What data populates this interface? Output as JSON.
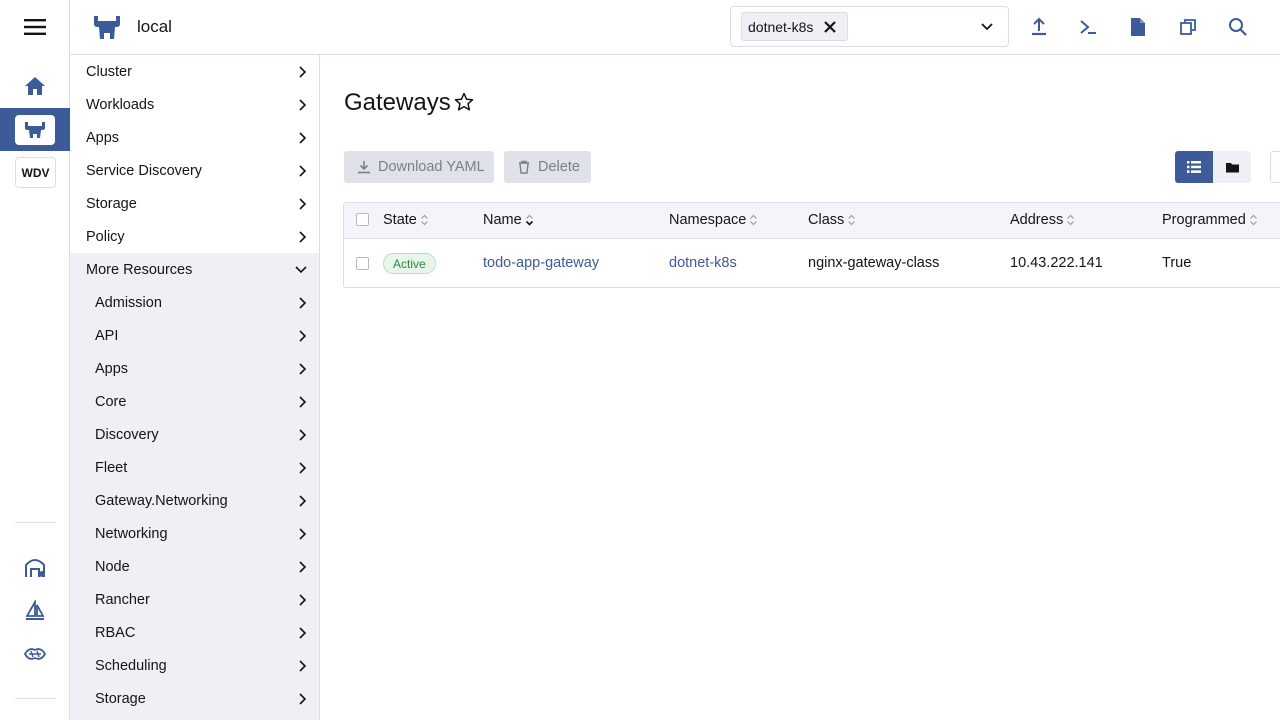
{
  "header": {
    "cluster_name": "local",
    "namespace_chip": "dotnet-k8s"
  },
  "rail": {
    "wdv_label": "WDV"
  },
  "sidenav": {
    "top_items": [
      {
        "label": "Cluster"
      },
      {
        "label": "Workloads"
      },
      {
        "label": "Apps"
      },
      {
        "label": "Service Discovery"
      },
      {
        "label": "Storage"
      },
      {
        "label": "Policy"
      }
    ],
    "open_group": {
      "label": "More Resources"
    },
    "sub_items": [
      {
        "label": "Admission"
      },
      {
        "label": "API"
      },
      {
        "label": "Apps"
      },
      {
        "label": "Core"
      },
      {
        "label": "Discovery"
      },
      {
        "label": "Fleet"
      },
      {
        "label": "Gateway.Networking"
      },
      {
        "label": "Networking"
      },
      {
        "label": "Node"
      },
      {
        "label": "Rancher"
      },
      {
        "label": "RBAC"
      },
      {
        "label": "Scheduling"
      },
      {
        "label": "Storage"
      }
    ]
  },
  "main": {
    "title": "Gateways",
    "download_label": "Download YAML",
    "delete_label": "Delete",
    "columns": [
      "State",
      "Name",
      "Namespace",
      "Class",
      "Address",
      "Programmed"
    ],
    "rows": [
      {
        "state": "Active",
        "name": "todo-app-gateway",
        "namespace": "dotnet-k8s",
        "class": "nginx-gateway-class",
        "address": "10.43.222.141",
        "programmed": "True"
      }
    ]
  },
  "colors": {
    "accent": "#3d5a99",
    "active_badge": "#2e8540"
  }
}
